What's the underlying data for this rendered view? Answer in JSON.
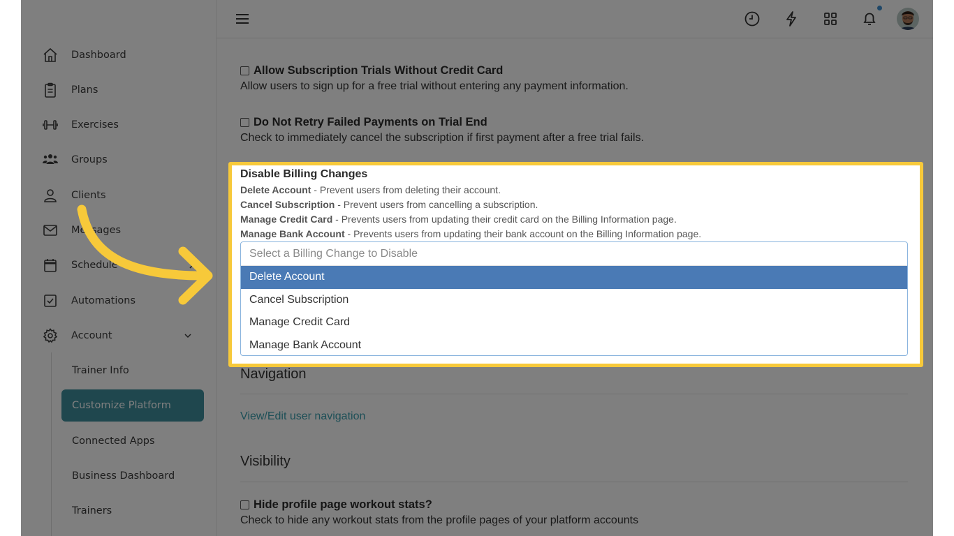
{
  "sidebar": {
    "items": [
      {
        "label": "Dashboard",
        "icon": "home-icon"
      },
      {
        "label": "Plans",
        "icon": "clipboard-icon"
      },
      {
        "label": "Exercises",
        "icon": "dumbbell-icon"
      },
      {
        "label": "Groups",
        "icon": "users-icon"
      },
      {
        "label": "Clients",
        "icon": "user-icon"
      },
      {
        "label": "Messages",
        "icon": "mail-icon"
      },
      {
        "label": "Schedule",
        "icon": "calendar-icon"
      },
      {
        "label": "Automations",
        "icon": "checkbox-icon"
      },
      {
        "label": "Account",
        "icon": "gear-icon"
      }
    ],
    "account_sub": [
      {
        "label": "Trainer Info"
      },
      {
        "label": "Customize Platform",
        "active": true
      },
      {
        "label": "Connected Apps"
      },
      {
        "label": "Business Dashboard"
      },
      {
        "label": "Trainers"
      }
    ]
  },
  "topbar": {
    "icons": [
      "menu-icon",
      "clock-icon",
      "lightning-icon",
      "grid-icon",
      "bell-icon",
      "avatar"
    ],
    "notification_dot_color": "#3f8fd0"
  },
  "content": {
    "opt1": {
      "title": "Allow Subscription Trials Without Credit Card",
      "desc": "Allow users to sign up for a free trial without entering any payment information."
    },
    "opt2": {
      "title": "Do Not Retry Failed Payments on Trial End",
      "desc": "Check to immediately cancel the subscription if first payment after a free trial fails."
    },
    "billing": {
      "title": "Disable Billing Changes",
      "rows": [
        {
          "name": "Delete Account",
          "desc": " - Prevent users from deleting their account."
        },
        {
          "name": "Cancel Subscription",
          "desc": " - Prevent users from cancelling a subscription."
        },
        {
          "name": "Manage Credit Card",
          "desc": " - Prevents users from updating their credit card on the Billing Information page."
        },
        {
          "name": "Manage Bank Account",
          "desc": " - Prevents users from updating their bank account on the Billing Information page."
        }
      ],
      "select_placeholder": "Select a Billing Change to Disable",
      "options": [
        "Delete Account",
        "Cancel Subscription",
        "Manage Credit Card",
        "Manage Bank Account"
      ],
      "highlighted_option": "Delete Account"
    },
    "navigation": {
      "title": "Navigation",
      "link": "View/Edit user navigation"
    },
    "visibility": {
      "title": "Visibility",
      "opt_title": "Hide profile page workout stats?",
      "opt_desc": "Check to hide any workout stats from the profile pages of your platform accounts"
    }
  },
  "colors": {
    "accent": "#3f8f9c",
    "highlight_border": "#f7c93a",
    "select_active": "#4a7ab5",
    "link": "#3b9fae"
  }
}
